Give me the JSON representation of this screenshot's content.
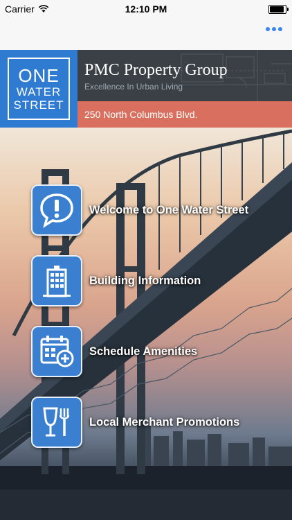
{
  "status_bar": {
    "carrier": "Carrier",
    "time": "12:10 PM"
  },
  "nav_bar": {
    "more_icon": "more-horizontal-icon"
  },
  "header": {
    "logo": {
      "line1": "ONE",
      "line2": "WATER",
      "line3": "STREET"
    },
    "company_name": "PMC Property Group",
    "tagline": "Excellence In Urban Living",
    "address": "250 North Columbus Blvd."
  },
  "menu": {
    "items": [
      {
        "label": "Welcome to One Water Street",
        "icon": "exclamation-bubble-icon"
      },
      {
        "label": "Building Information",
        "icon": "building-icon"
      },
      {
        "label": "Schedule Amenities",
        "icon": "calendar-add-icon"
      },
      {
        "label": "Local Merchant Promotions",
        "icon": "dining-icon"
      }
    ]
  },
  "colors": {
    "logo_blue": "#2f7bd1",
    "header_dark": "#3a4045",
    "address_salmon": "#d9705f",
    "icon_blue": "#3a7fd0",
    "ios_blue": "#3b86f0"
  }
}
